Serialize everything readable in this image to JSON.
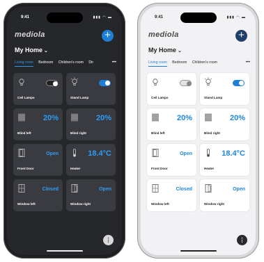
{
  "status": {
    "time": "9:41",
    "icons": "signal wifi battery"
  },
  "brand": {
    "logo_text": "mediola"
  },
  "header": {
    "home_title": "My Home",
    "add_icon": "plus-icon",
    "chevron_icon": "chevron-down-icon"
  },
  "tabs": [
    {
      "label": "Living room",
      "active": true
    },
    {
      "label": "Bedroom",
      "active": false
    },
    {
      "label": "Children's room",
      "active": false
    },
    {
      "label": "Dir",
      "active": false
    }
  ],
  "more_tabs_label": "•••",
  "devices": [
    {
      "name": "Ceil Lamps",
      "type": "toggle",
      "state": "off",
      "icon": "lamp-icon"
    },
    {
      "name": "Stand Lamp",
      "type": "toggle",
      "state": "on",
      "icon": "lamp-on-icon"
    },
    {
      "name": "Blind left",
      "type": "value",
      "value": "20%",
      "icon": "blind-icon"
    },
    {
      "name": "Blind right",
      "type": "value",
      "value": "20%",
      "icon": "blind-icon"
    },
    {
      "name": "Front Door",
      "type": "value",
      "value": "Open",
      "icon": "door-icon"
    },
    {
      "name": "Heater",
      "type": "value",
      "value": "18.4°C",
      "icon": "thermometer-icon"
    },
    {
      "name": "Window left",
      "type": "value",
      "value": "Closed",
      "icon": "window-icon"
    },
    {
      "name": "Window right",
      "type": "value",
      "value": "Open",
      "icon": "window-open-icon"
    }
  ],
  "fab_label": "⋮",
  "colors": {
    "accent_dark": "#2e9cf4",
    "accent_light": "#1e86dd",
    "add_dark": "#1e7fd6",
    "add_light": "#1f3f6b"
  }
}
